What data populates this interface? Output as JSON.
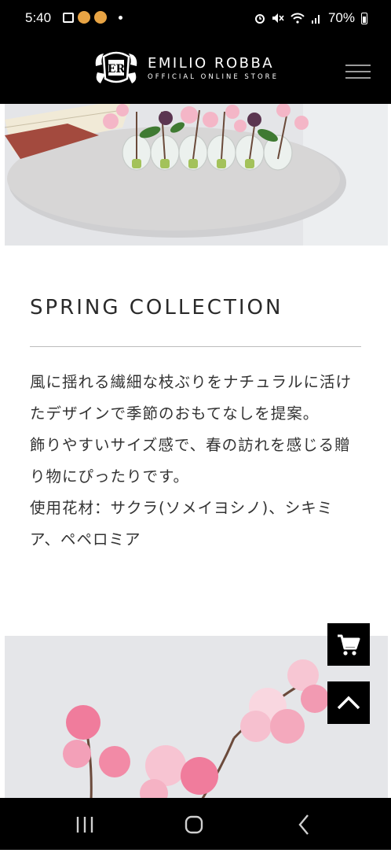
{
  "status_bar": {
    "time": "5:40",
    "battery": "70%",
    "icons": [
      "gallery-icon",
      "app-coin-icon",
      "app-coin-icon",
      "dot-icon",
      "alarm-icon",
      "mute-icon",
      "wifi-icon",
      "signal-icon",
      "battery-icon"
    ]
  },
  "header": {
    "logo_monogram": "ER",
    "brand_name": "EMILIO ROBBA",
    "brand_tagline": "OFFICIAL ONLINE STORE",
    "menu_icon": "hamburger-menu-icon"
  },
  "collection": {
    "title": "SPRING COLLECTION",
    "paragraphs": [
      "風に揺れる繊細な枝ぶりをナチュラルに活けたデザインで季節のおもてなしを提案。",
      "飾りやすいサイズ感で、春の訪れを感じる贈り物にぴったりです。",
      "使用花材：サクラ(ソメイヨシノ)、シキミア、ペペロミア"
    ]
  },
  "floating": {
    "cart_icon": "cart-icon",
    "top_icon": "chevron-up-icon"
  },
  "nav_bar": {
    "icons": [
      "recent-apps-icon",
      "home-icon",
      "back-icon"
    ]
  },
  "colors": {
    "header_bg": "#000000",
    "blossom_pink": "#f2a7c0",
    "text": "#333333"
  }
}
